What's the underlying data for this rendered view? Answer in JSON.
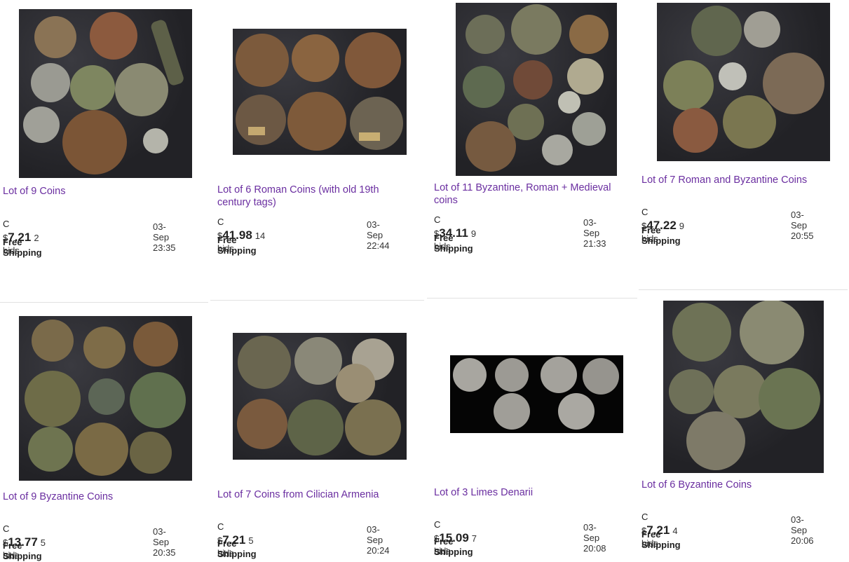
{
  "listings": [
    {
      "title": "Lot of 9 Coins",
      "currency": "C $",
      "price": "7.21",
      "bids": "2 bids",
      "date": "03-Sep 23:35",
      "shipping": "Free Shipping",
      "image": "coin-lot-9-mixed"
    },
    {
      "title": "Lot of 6 Roman Coins (with old 19th century tags)",
      "currency": "C $",
      "price": "41.98",
      "bids": "14 bids",
      "date": "03-Sep 22:44",
      "shipping": "Free Shipping",
      "image": "coin-lot-6-roman-tags"
    },
    {
      "title": "Lot of 11 Byzantine, Roman + Medieval coins",
      "currency": "C $",
      "price": "34.11",
      "bids": "9 bids",
      "date": "03-Sep 21:33",
      "shipping": "Free Shipping",
      "image": "coin-lot-11-mixed"
    },
    {
      "title": "Lot of 7 Roman and Byzantine Coins",
      "currency": "C $",
      "price": "47.22",
      "bids": "9 bids",
      "date": "03-Sep 20:55",
      "shipping": "Free Shipping",
      "image": "coin-lot-7-roman-byz"
    },
    {
      "title": "Lot of 9 Byzantine Coins",
      "currency": "C $",
      "price": "13.77",
      "bids": "5 bids",
      "date": "03-Sep 20:35",
      "shipping": "Free Shipping",
      "image": "coin-lot-9-byzantine"
    },
    {
      "title": "Lot of 7 Coins from Cilician Armenia",
      "currency": "C $",
      "price": "7.21",
      "bids": "5 bids",
      "date": "03-Sep 20:24",
      "shipping": "Free Shipping",
      "image": "coin-lot-7-cilician"
    },
    {
      "title": "Lot of 3 Limes Denarii",
      "currency": "C $",
      "price": "15.09",
      "bids": "7 bids",
      "date": "03-Sep 20:08",
      "shipping": "Free Shipping",
      "image": "coin-lot-limes-denarii"
    },
    {
      "title": "Lot of 6 Byzantine Coins",
      "currency": "C $",
      "price": "7.21",
      "bids": "4 bids",
      "date": "03-Sep 20:06",
      "shipping": "Free Shipping",
      "image": "coin-lot-6-byzantine"
    }
  ],
  "colors": {
    "title_link": "#6a2ea0",
    "coin_bronze": "#7a5a3a",
    "coin_green": "#6f7a55",
    "coin_silver": "#a8a8a0"
  }
}
